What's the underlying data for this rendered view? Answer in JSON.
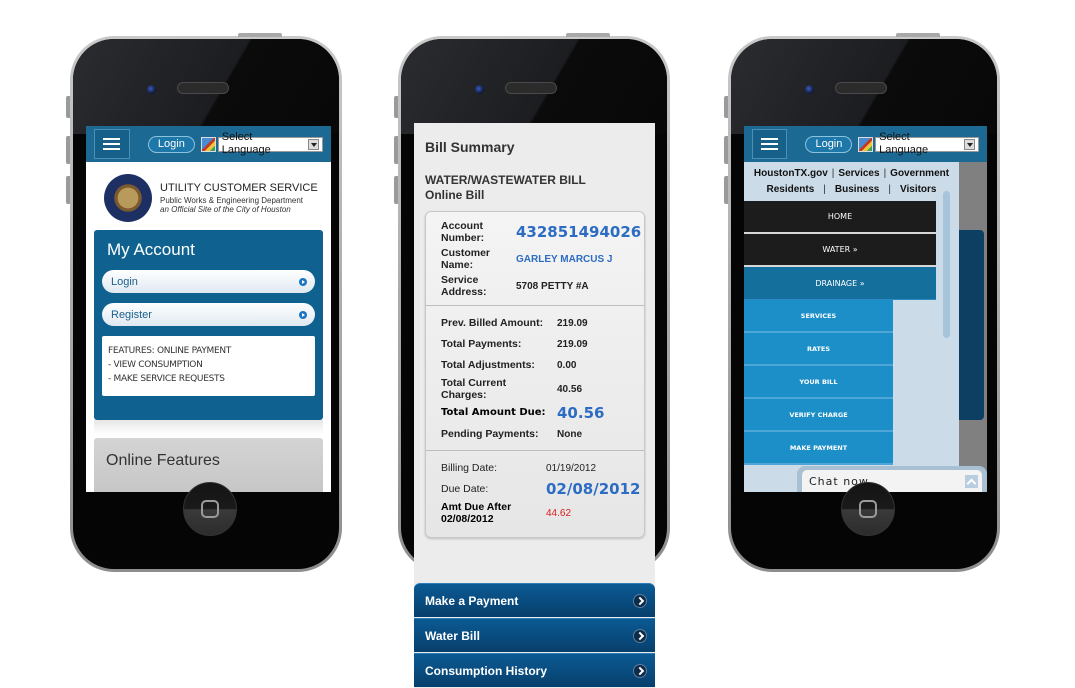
{
  "phone1": {
    "header": {
      "menu_icon": "hamburger-menu-icon",
      "login_label": "Login",
      "language_select": "Select Language"
    },
    "brand": {
      "title": "UTILITY CUSTOMER SERVICE",
      "subtitle": "Public Works & Engineering Department",
      "tagline": "an Official Site of the City of Houston"
    },
    "my_account": {
      "title": "My Account",
      "buttons": [
        {
          "label": "Login"
        },
        {
          "label": "Register"
        }
      ],
      "features": [
        "FEATURES: ONLINE PAYMENT",
        "- VIEW CONSUMPTION",
        "- MAKE SERVICE REQUESTS"
      ]
    },
    "online_features_title": "Online Features"
  },
  "phone2": {
    "title": "Bill Summary",
    "bill_type": "WATER/WASTEWATER BILL",
    "bill_subtype": "Online Bill",
    "account_section": [
      {
        "label": "Account Number:",
        "value": "432851494026"
      },
      {
        "label": "Customer Name:",
        "value": "GARLEY MARCUS J"
      },
      {
        "label": "Service Address:",
        "value": "5708 PETTY #A"
      }
    ],
    "amounts_section": [
      {
        "label": "Prev. Billed Amount:",
        "value": "219.09"
      },
      {
        "label": "Total Payments:",
        "value": "219.09"
      },
      {
        "label": "Total Adjustments:",
        "value": "0.00"
      },
      {
        "label": "Total Current Charges:",
        "value": "40.56"
      },
      {
        "label": "Total Amount Due:",
        "value": "40.56"
      },
      {
        "label": "Pending Payments:",
        "value": "None"
      }
    ],
    "dates_section": [
      {
        "label": "Billing Date:",
        "value": "01/19/2012"
      },
      {
        "label": "Due Date:",
        "value": "02/08/2012"
      },
      {
        "label": "Amt Due After 02/08/2012",
        "value": "44.62"
      }
    ],
    "nav_buttons": [
      {
        "label": "Make a Payment"
      },
      {
        "label": "Water Bill"
      },
      {
        "label": "Consumption History"
      }
    ],
    "colors": {
      "accent_blue": "#2d6cc3",
      "late_red": "#d7201f",
      "nav_blue": "#0b5a94"
    }
  },
  "phone3": {
    "header": {
      "login_label": "Login",
      "language_select": "Select Language"
    },
    "top_links_row1": [
      "HoustonTX.gov",
      "Services",
      "Government"
    ],
    "top_links_row2": [
      "Residents",
      "Business",
      "Visitors"
    ],
    "menu_items": [
      {
        "label": "HOME"
      },
      {
        "label": "WATER »"
      },
      {
        "label": "DRAINAGE »"
      }
    ],
    "submenu_items": [
      {
        "label": "SERVICES"
      },
      {
        "label": "RATES"
      },
      {
        "label": "YOUR BILL"
      },
      {
        "label": "VERIFY CHARGE"
      },
      {
        "label": "MAKE PAYMENT"
      }
    ],
    "chat_label": "Chat now"
  }
}
